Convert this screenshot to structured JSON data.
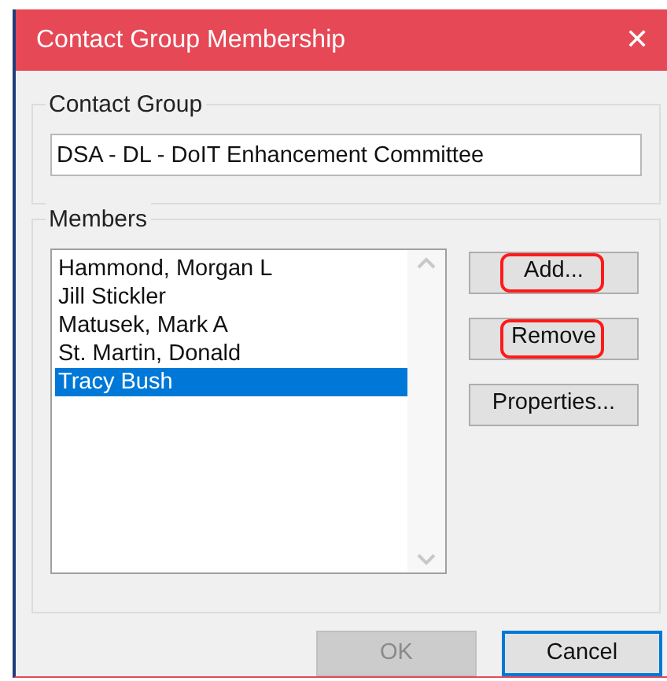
{
  "window": {
    "title": "Contact Group Membership",
    "close": "✕"
  },
  "contact_group": {
    "label": "Contact Group",
    "value": "DSA - DL - DoIT Enhancement Committee"
  },
  "members": {
    "label": "Members",
    "items": [
      {
        "name": "Hammond, Morgan L",
        "selected": false
      },
      {
        "name": "Jill Stickler",
        "selected": false
      },
      {
        "name": "Matusek, Mark A",
        "selected": false
      },
      {
        "name": "St. Martin, Donald",
        "selected": false
      },
      {
        "name": "Tracy Bush",
        "selected": true
      }
    ]
  },
  "side_buttons": [
    {
      "label": "Add...",
      "annotated": true
    },
    {
      "label": "Remove",
      "annotated": true
    },
    {
      "label": "Properties...",
      "annotated": false
    }
  ],
  "footer_buttons": [
    {
      "label": "OK",
      "disabled": true,
      "default": false
    },
    {
      "label": "Cancel",
      "disabled": false,
      "default": true
    }
  ]
}
